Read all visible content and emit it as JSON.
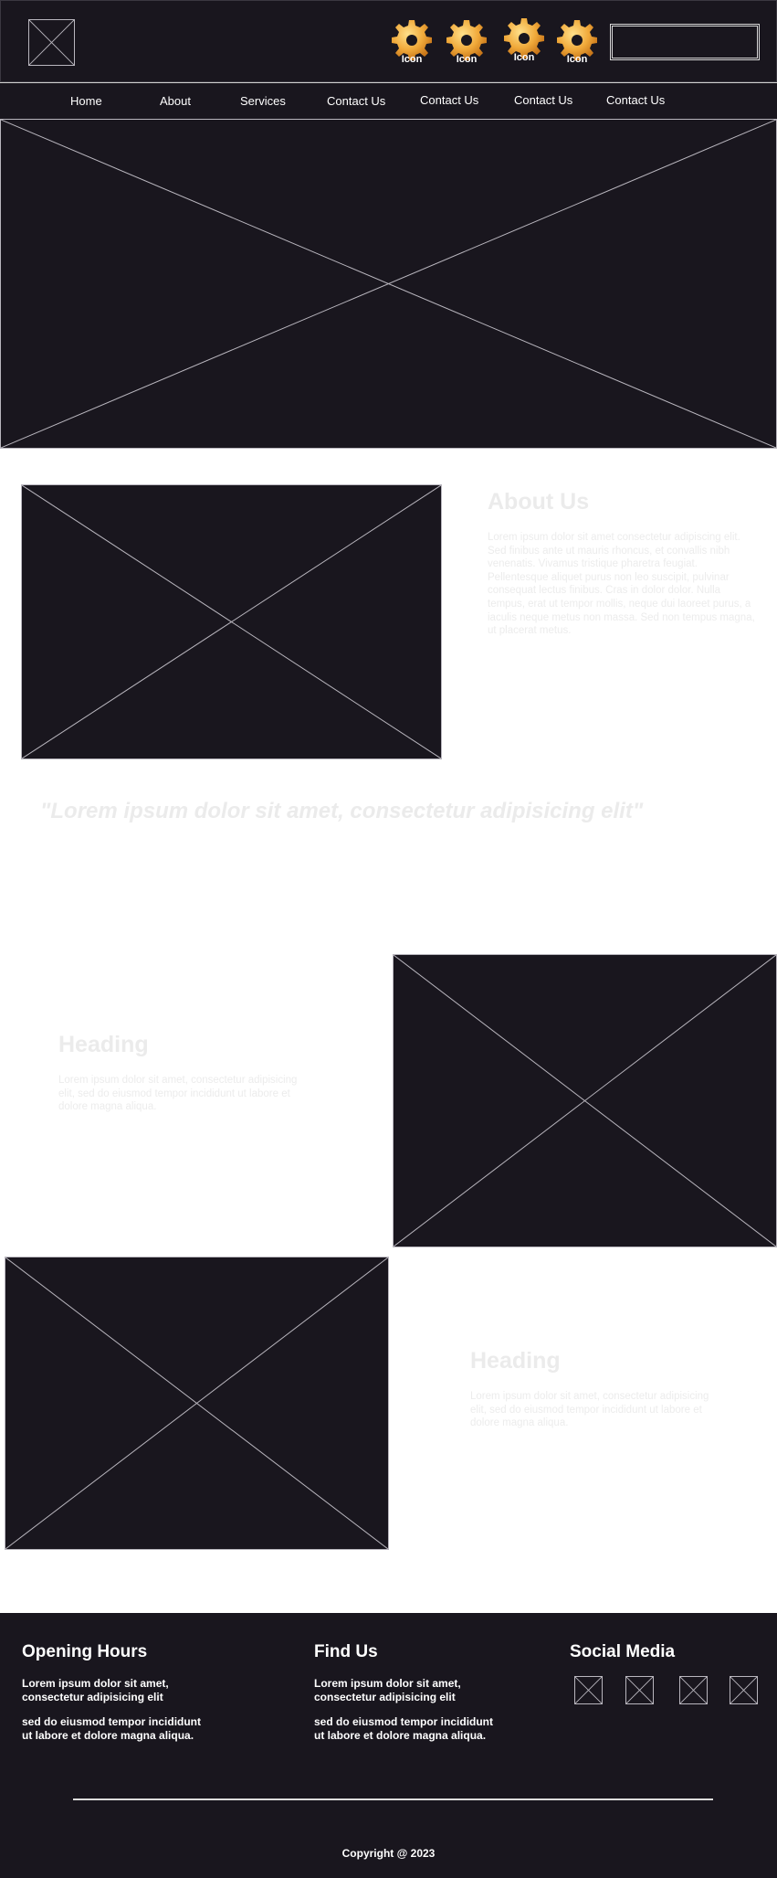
{
  "header": {
    "icons": [
      {
        "label": "Icon",
        "icon": "gear-icon"
      },
      {
        "label": "Icon",
        "icon": "gear-icon"
      },
      {
        "label": "Icon",
        "icon": "gear-icon"
      },
      {
        "label": "Icon",
        "icon": "gear-icon"
      }
    ],
    "search": {
      "value": "",
      "placeholder": ""
    }
  },
  "nav": {
    "items": [
      {
        "label": "Home"
      },
      {
        "label": "About"
      },
      {
        "label": "Services"
      },
      {
        "label": "Contact Us"
      },
      {
        "label": "Contact Us"
      },
      {
        "label": "Contact Us"
      },
      {
        "label": "Contact Us"
      }
    ]
  },
  "about": {
    "title": "About Us",
    "body": "Lorem ipsum dolor sit amet consectetur adipiscing elit. Sed finibus ante ut mauris rhoncus, et convallis nibh venenatis. Vivamus tristique pharetra feugiat. Pellentesque aliquet purus non leo suscipit, pulvinar consequat lectus finibus. Cras in dolor dolor. Nulla tempus, erat ut tempor mollis, neque dui laoreet purus, a iaculis neque metus non massa. Sed non tempus magna, ut placerat metus."
  },
  "quote": "\"Lorem ipsum dolor sit amet, consectetur adipisicing elit\"",
  "feature1": {
    "heading": "Heading",
    "body": "Lorem ipsum dolor sit amet, consectetur adipisicing elit, sed do eiusmod tempor incididunt ut labore et dolore magna aliqua."
  },
  "feature2": {
    "heading": "Heading",
    "body": "Lorem ipsum dolor sit amet, consectetur adipisicing elit, sed do eiusmod tempor incididunt ut labore et dolore magna aliqua."
  },
  "footer": {
    "opening": {
      "title": "Opening Hours",
      "line1": "Lorem ipsum dolor sit amet, consectetur adipisicing elit",
      "line2": "sed do eiusmod tempor incididunt ut labore et dolore magna aliqua."
    },
    "find": {
      "title": "Find Us",
      "line1": "Lorem ipsum dolor sit amet, consectetur adipisicing elit",
      "line2": "sed do eiusmod tempor incididunt ut labore et dolore magna aliqua."
    },
    "social": {
      "title": "Social Media"
    },
    "copyright": "Copyright @ 2023"
  },
  "colors": {
    "dark": "#19161e",
    "placeholder_line": "#b9b6be",
    "pale_text": "#ebebeb",
    "gear": "#f0a93a"
  }
}
